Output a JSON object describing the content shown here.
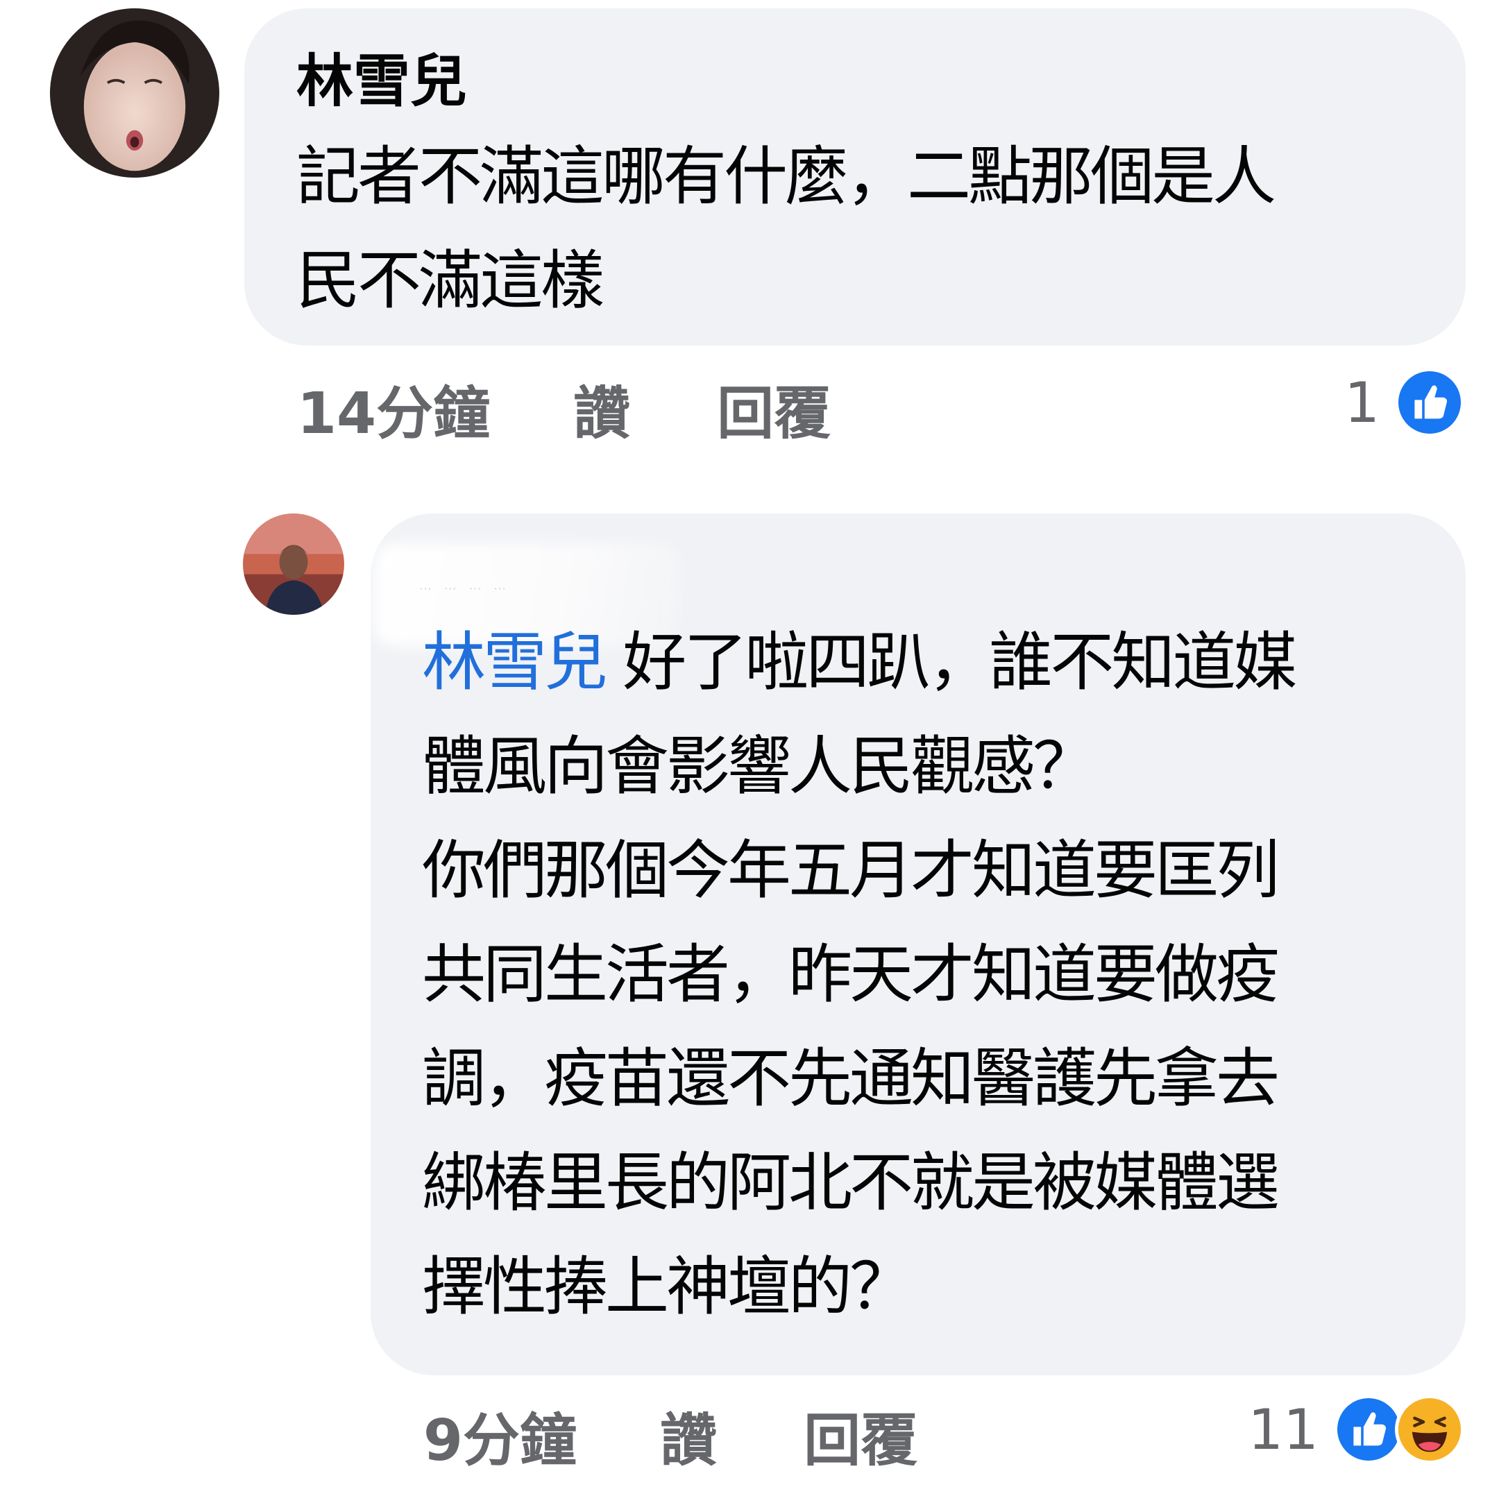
{
  "comments": [
    {
      "author": "林雪兒",
      "text_lines": [
        "記者不滿這哪有什麼，二點那個是人",
        "民不滿這樣"
      ],
      "time": "14分鐘",
      "like_label": "讚",
      "reply_label": "回覆",
      "reaction_count": "1",
      "reactions": [
        "like-icon"
      ]
    },
    {
      "author": "",
      "mention": "林雪兒",
      "text_first_line_rest": " 好了啦四趴，誰不知道媒",
      "text_lines": [
        "體風向會影響人民觀感？",
        "你們那個今年五月才知道要匡列",
        "共同生活者，昨天才知道要做疫",
        "調，疫苗還不先通知醫護先拿去",
        "綁椿里長的阿北不就是被媒體選",
        "擇性捧上神壇的？"
      ],
      "time": "9分鐘",
      "like_label": "讚",
      "reply_label": "回覆",
      "reaction_count": "11",
      "reactions": [
        "like-icon",
        "haha-icon"
      ]
    }
  ],
  "colors": {
    "bubble_bg": "#f0f2f5",
    "meta_text": "#65676b",
    "mention": "#216fdb",
    "like_blue": "#1877f2",
    "haha_yellow": "#f7b125"
  }
}
